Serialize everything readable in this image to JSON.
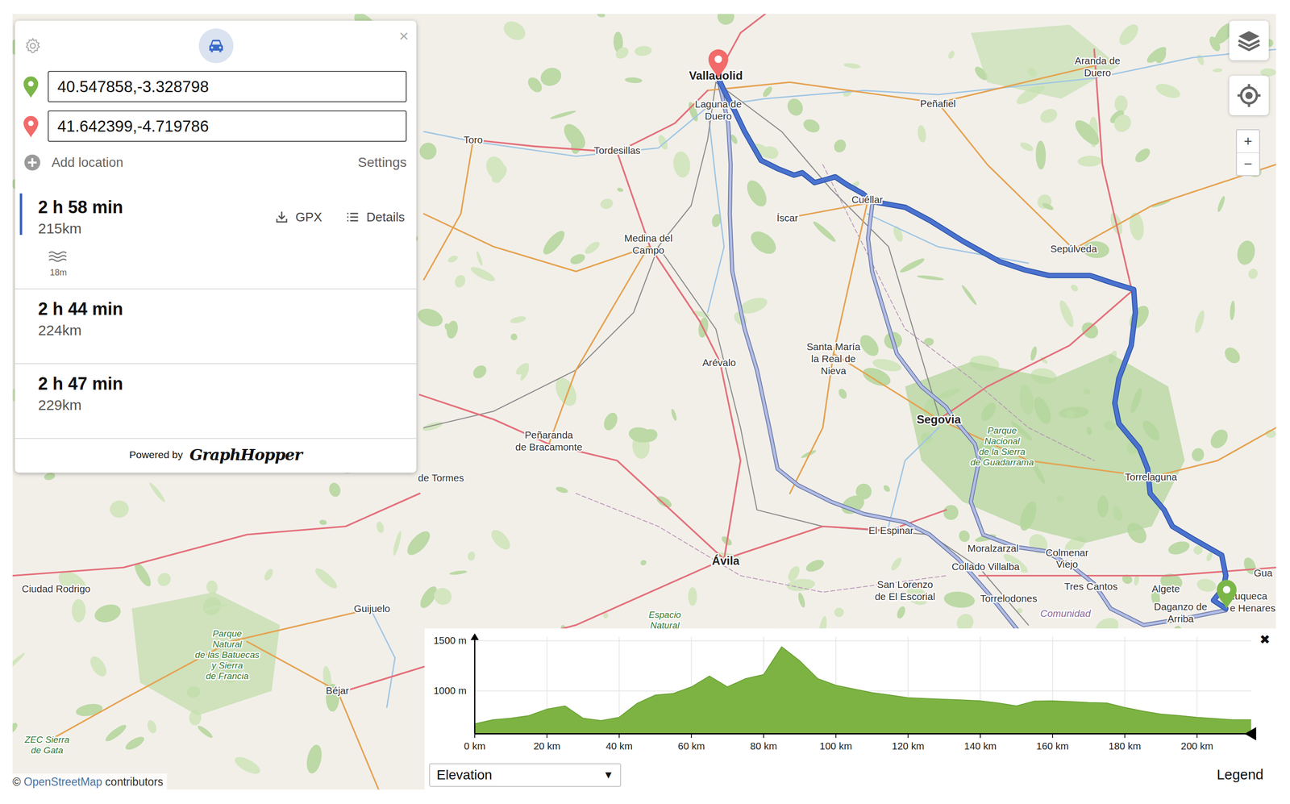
{
  "search": {
    "from": "40.547858,-3.328798",
    "to": "41.642399,-4.719786",
    "add_location": "Add location",
    "settings": "Settings",
    "close": "×"
  },
  "routes": [
    {
      "time": "2 h 58 min",
      "distance": "215km",
      "selected": true
    },
    {
      "time": "2 h 44 min",
      "distance": "224km",
      "selected": false
    },
    {
      "time": "2 h 47 min",
      "distance": "229km",
      "selected": false
    }
  ],
  "route_actions": [
    "GPX",
    "Details"
  ],
  "route_details": {
    "ford": "18m"
  },
  "footer": {
    "powered_by": "Powered by",
    "logo": "GraphHopper"
  },
  "map": {
    "labels": [
      {
        "lines": [
          "Valladolid"
        ],
        "kind": "city"
      },
      {
        "lines": [
          "Laguna de",
          "Duero"
        ],
        "kind": "town"
      },
      {
        "lines": [
          "Toro"
        ],
        "kind": "town"
      },
      {
        "lines": [
          "Tordesillas"
        ],
        "kind": "town"
      },
      {
        "lines": [
          "Peñafiel"
        ],
        "kind": "town"
      },
      {
        "lines": [
          "Aranda de",
          "Duero"
        ],
        "kind": "town"
      },
      {
        "lines": [
          "Cuéllar"
        ],
        "kind": "town"
      },
      {
        "lines": [
          "Íscar"
        ],
        "kind": "town"
      },
      {
        "lines": [
          "Medina del",
          "Campo"
        ],
        "kind": "town"
      },
      {
        "lines": [
          "Sepúlveda"
        ],
        "kind": "town"
      },
      {
        "lines": [
          "Santa María",
          "la Real de",
          "Nieva"
        ],
        "kind": "town"
      },
      {
        "lines": [
          "Arévalo"
        ],
        "kind": "town"
      },
      {
        "lines": [
          "Segovia"
        ],
        "kind": "city"
      },
      {
        "lines": [
          "Parque",
          "Nacional",
          "de la Sierra",
          "de Guadarrama"
        ],
        "kind": "park"
      },
      {
        "lines": [
          "Torrelaguna"
        ],
        "kind": "town"
      },
      {
        "lines": [
          "Peñaranda",
          "de Bracamonte"
        ],
        "kind": "town"
      },
      {
        "lines": [
          "de Tormes"
        ],
        "kind": "town"
      },
      {
        "lines": [
          "El Espinar"
        ],
        "kind": "town"
      },
      {
        "lines": [
          "Moralzarzal"
        ],
        "kind": "town"
      },
      {
        "lines": [
          "Colmenar",
          "Viejo"
        ],
        "kind": "town"
      },
      {
        "lines": [
          "Collado Villalba"
        ],
        "kind": "town"
      },
      {
        "lines": [
          "San Lorenzo",
          "de El Escorial"
        ],
        "kind": "town"
      },
      {
        "lines": [
          "Torrelodones"
        ],
        "kind": "town"
      },
      {
        "lines": [
          "Tres Cantos"
        ],
        "kind": "town"
      },
      {
        "lines": [
          "Algete"
        ],
        "kind": "town"
      },
      {
        "lines": [
          "Daganzo de",
          "Arriba"
        ],
        "kind": "town"
      },
      {
        "lines": [
          "zuqueca",
          "e Henares"
        ],
        "kind": "town"
      },
      {
        "lines": [
          "Gua"
        ],
        "kind": "town"
      },
      {
        "lines": [
          "Ávila"
        ],
        "kind": "city"
      },
      {
        "lines": [
          "Ciudad Rodrigo"
        ],
        "kind": "town"
      },
      {
        "lines": [
          "Guijuelo"
        ],
        "kind": "town"
      },
      {
        "lines": [
          "Béjar"
        ],
        "kind": "town"
      },
      {
        "lines": [
          "Parque",
          "Natural",
          "de las Batuecas",
          "y Sierra",
          "de Francia"
        ],
        "kind": "park"
      },
      {
        "lines": [
          "ZEC Sierra",
          "de Gata"
        ],
        "kind": "park"
      },
      {
        "lines": [
          "Espacio",
          "Natural"
        ],
        "kind": "park"
      },
      {
        "lines": [
          "Comunidad"
        ],
        "kind": "region"
      }
    ],
    "zoom": [
      "+",
      "−"
    ],
    "attribution": {
      "symbol": "©",
      "link": "OpenStreetMap",
      "rest": "contributors"
    }
  },
  "elevation_chart": {
    "y_ticks": [
      {
        "label": "1500 m",
        "value": 1500
      },
      {
        "label": "1000 m",
        "value": 1000
      }
    ],
    "x_ticks": [
      {
        "label": "0 km",
        "value": 0
      },
      {
        "label": "20 km",
        "value": 20
      },
      {
        "label": "40 km",
        "value": 40
      },
      {
        "label": "60 km",
        "value": 60
      },
      {
        "label": "80 km",
        "value": 80
      },
      {
        "label": "100 km",
        "value": 100
      },
      {
        "label": "120 km",
        "value": 120
      },
      {
        "label": "140 km",
        "value": 140
      },
      {
        "label": "160 km",
        "value": 160
      },
      {
        "label": "180 km",
        "value": 180
      },
      {
        "label": "200 km",
        "value": 200
      }
    ],
    "series": [
      {
        "name": "Elevation",
        "step_km": 5,
        "values": [
          672,
          713,
          729,
          754,
          820,
          852,
          729,
          705,
          738,
          877,
          959,
          975,
          1041,
          1148,
          1041,
          1123,
          1164,
          1440,
          1300,
          1123,
          1057,
          1020,
          984,
          960,
          934,
          925,
          918,
          910,
          902,
          880,
          852,
          900,
          902,
          895,
          885,
          880,
          836,
          800,
          770,
          755,
          738,
          725,
          713,
          713
        ]
      }
    ],
    "dropdown": {
      "value": "Elevation",
      "arrow": "▼"
    },
    "legend": "Legend",
    "close": "✖"
  }
}
